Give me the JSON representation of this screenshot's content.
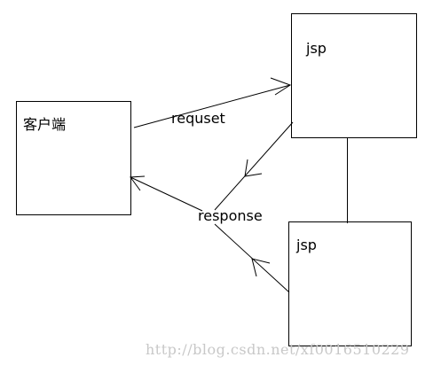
{
  "nodes": {
    "client": {
      "label": "客户端"
    },
    "jsp_top": {
      "label": "jsp"
    },
    "jsp_bottom": {
      "label": "jsp"
    }
  },
  "edges": {
    "request": {
      "label": "requset"
    },
    "response": {
      "label": "response"
    }
  },
  "watermark": {
    "text": "http://blog.csdn.net/xf0016510229"
  },
  "colors": {
    "stroke": "#000000",
    "background": "#ffffff",
    "watermark": "#c8c8c8"
  }
}
